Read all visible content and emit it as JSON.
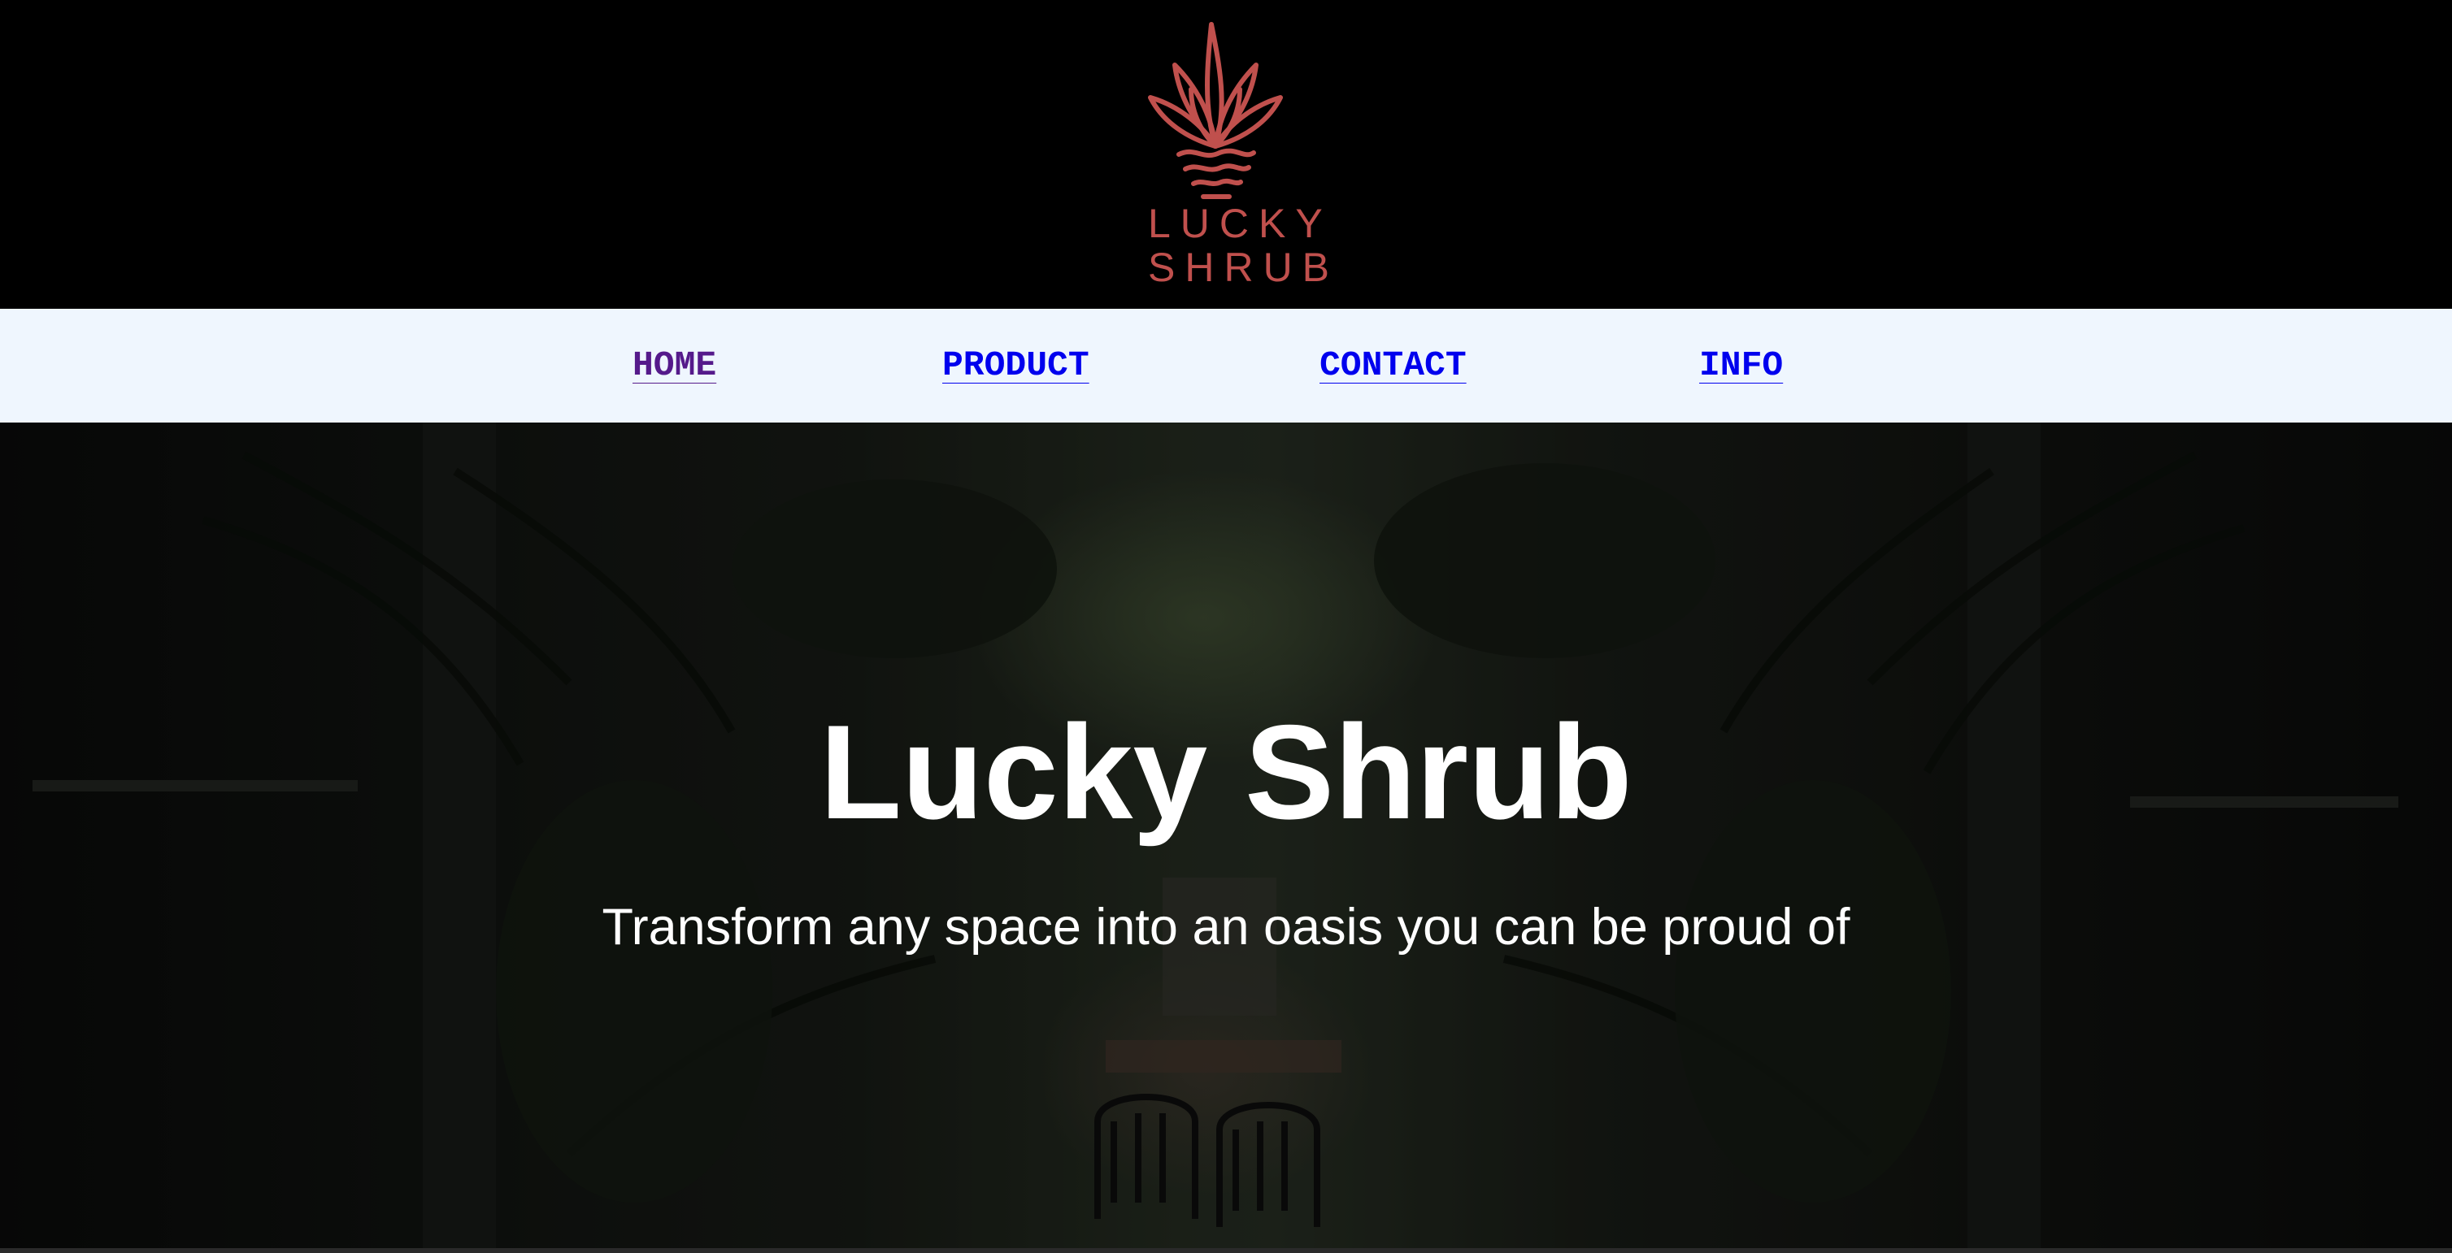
{
  "header": {
    "logo": {
      "icon": "succulent-plant-icon",
      "line1": "LUCKY",
      "line2": "SHRUB",
      "color": "#c0504d"
    }
  },
  "nav": {
    "items": [
      {
        "label": "HOME",
        "visited": true
      },
      {
        "label": "PRODUCT",
        "visited": false
      },
      {
        "label": "CONTACT",
        "visited": false
      },
      {
        "label": "INFO",
        "visited": false
      }
    ],
    "link_color": "#0000ee",
    "visited_color": "#551a8b",
    "background": "#eff6fe"
  },
  "hero": {
    "title": "Lucky Shrub",
    "subtitle": "Transform any space into an oasis you can be proud of",
    "background_image": "tropical-courtyard-garden-photo"
  }
}
